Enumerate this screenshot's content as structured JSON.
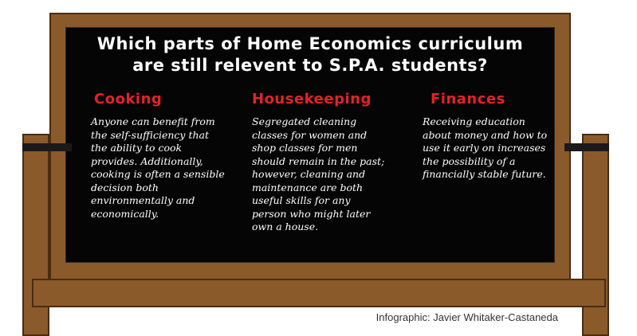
{
  "title": {
    "line1": "Which parts of Home Economics curriculum",
    "line2": "are still relevent to S.P.A. students?"
  },
  "columns": [
    {
      "heading": "Cooking",
      "text": "Anyone can benefit from the self-sufficiency that the ability to cook provides. Additionally, cooking is often a sensible decision both environmentally and economically."
    },
    {
      "heading": "Housekeeping",
      "text": "Segregated cleaning classes for women and shop classes for men should remain in the past; however, cleaning and maintenance are both useful skills for any person who might later own a house."
    },
    {
      "heading": "Finances",
      "text": "Receiving education about money and how to use it early on increases the possibility of a financially stable future."
    }
  ],
  "credit": "Infographic: Javier Whitaker-Castaneda",
  "colors": {
    "board": "#050505",
    "wood": "#8a5a2b",
    "heading": "#e0242a",
    "text": "#ffffff"
  }
}
